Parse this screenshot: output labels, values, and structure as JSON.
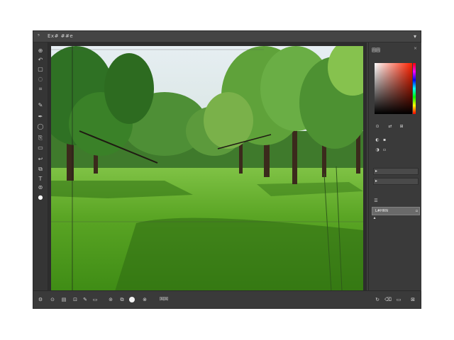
{
  "window": {
    "title": "Ex# ##e",
    "logo": "⁵",
    "control": "▾"
  },
  "toolbar": {
    "tools": [
      {
        "name": "move-tool",
        "glyph": "⊕"
      },
      {
        "name": "history-tool",
        "glyph": "↶"
      },
      {
        "name": "marquee-tool",
        "glyph": "▢"
      },
      {
        "name": "lasso-tool",
        "glyph": "◌"
      },
      {
        "name": "crop-tool",
        "glyph": "⌗"
      },
      {
        "name": "brush-tool",
        "glyph": "✎"
      },
      {
        "name": "pen-tool",
        "glyph": "✒"
      },
      {
        "name": "circle-tool",
        "glyph": "◯"
      },
      {
        "name": "stamp-tool",
        "glyph": "⎘"
      },
      {
        "name": "eraser-tool",
        "glyph": "▭"
      },
      {
        "name": "undo-tool",
        "glyph": "↩"
      },
      {
        "name": "clone-tool",
        "glyph": "⧉"
      },
      {
        "name": "text-tool",
        "glyph": "T"
      },
      {
        "name": "shape-tool",
        "glyph": "⊚"
      },
      {
        "name": "color-tool",
        "glyph": "●"
      }
    ]
  },
  "panel": {
    "header": "圆圆",
    "close": "×",
    "layer_name": "L#HRN"
  },
  "statusbar": {
    "text": "国国"
  }
}
